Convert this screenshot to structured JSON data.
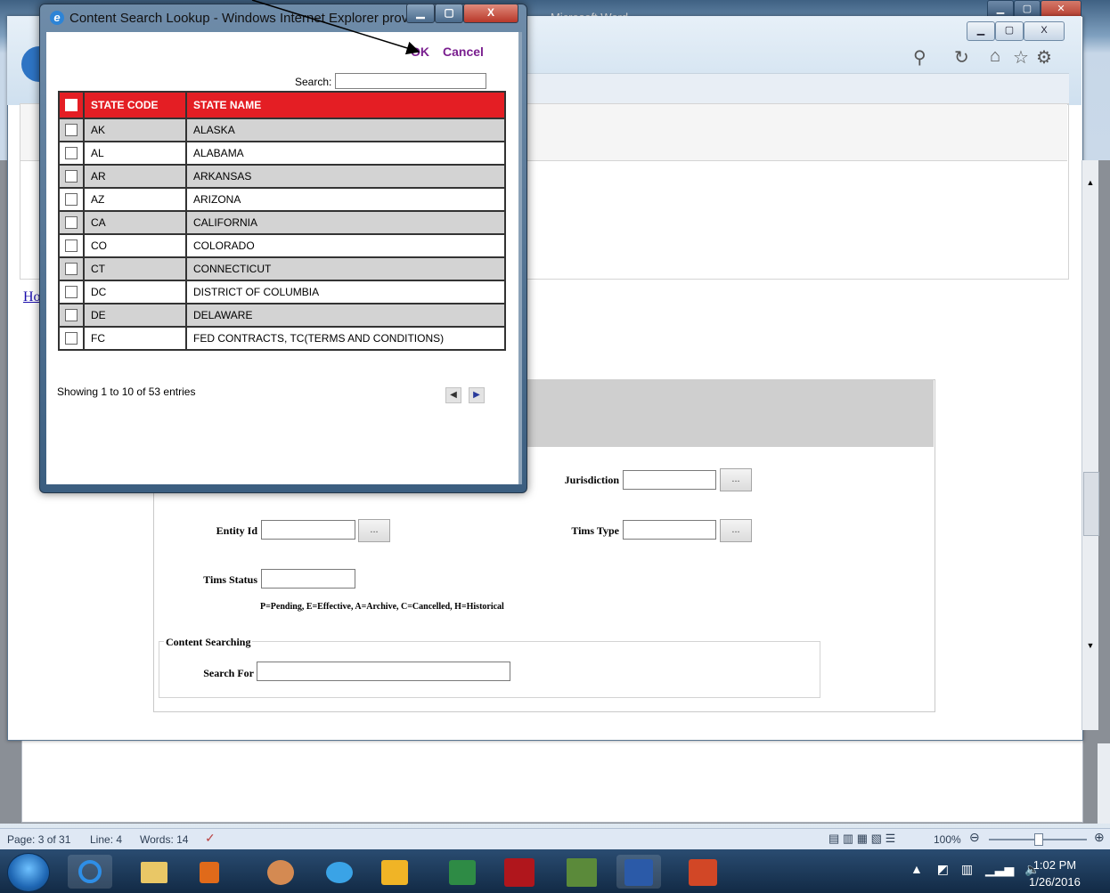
{
  "background_word": {
    "title_fragment": "- Microsoft Word",
    "statusbar": {
      "page": "Page: 3 of 31",
      "line": "Line: 4",
      "words": "Words: 14",
      "zoom": "100%"
    }
  },
  "browser": {
    "home_link": "Ho"
  },
  "form": {
    "jurisdiction_label": "Jurisdiction",
    "entity_id_label": "Entity Id",
    "tims_type_label": "Tims Type",
    "tims_status_label": "Tims Status",
    "lookup_button_label": "...",
    "status_hint": "P=Pending, E=Effective, A=Archive, C=Cancelled, H=Historical",
    "content_searching_legend": "Content Searching",
    "search_for_label": "Search For"
  },
  "dialog": {
    "title": "Content Search Lookup - Windows Internet Explorer provi...",
    "ok_label": "OK",
    "cancel_label": "Cancel",
    "search_label": "Search:",
    "search_value": "",
    "columns": [
      "STATE CODE",
      "STATE NAME"
    ],
    "rows": [
      {
        "code": "AK",
        "name": "ALASKA"
      },
      {
        "code": "AL",
        "name": "ALABAMA"
      },
      {
        "code": "AR",
        "name": "ARKANSAS"
      },
      {
        "code": "AZ",
        "name": "ARIZONA"
      },
      {
        "code": "CA",
        "name": "CALIFORNIA"
      },
      {
        "code": "CO",
        "name": "COLORADO"
      },
      {
        "code": "CT",
        "name": "CONNECTICUT"
      },
      {
        "code": "DC",
        "name": "DISTRICT OF COLUMBIA"
      },
      {
        "code": "DE",
        "name": "DELAWARE"
      },
      {
        "code": "FC",
        "name": "FED CONTRACTS, TC(TERMS AND CONDITIONS)"
      }
    ],
    "showing": "Showing 1 to 10 of 53 entries"
  },
  "taskbar": {
    "time": "1:02 PM",
    "date": "1/26/2016",
    "apps": [
      "start-orb",
      "internet-explorer",
      "file-explorer",
      "media-player",
      "paint-app",
      "lync",
      "outlook",
      "excel",
      "universal-id",
      "image-app",
      "word",
      "powerpoint"
    ]
  },
  "colors": {
    "header_red": "#e41e24",
    "link_purple": "#7a1f8f"
  }
}
